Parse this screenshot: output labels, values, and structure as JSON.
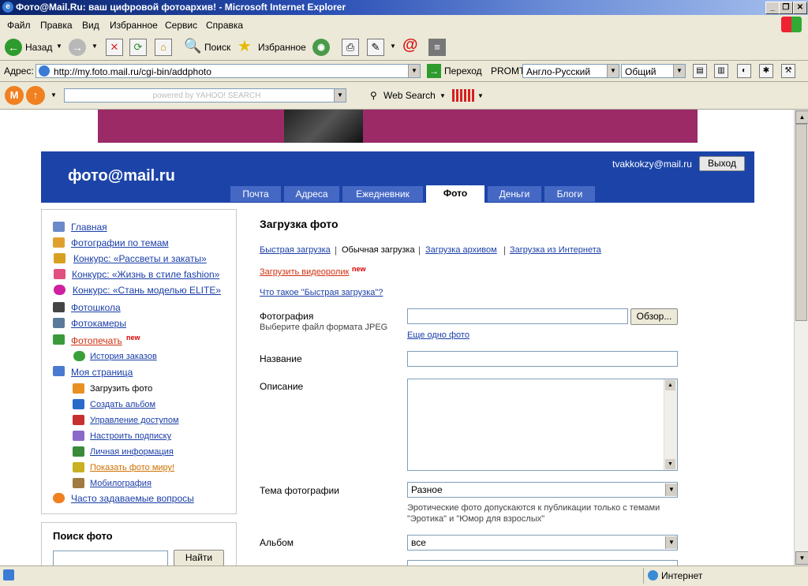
{
  "window": {
    "title": "Фото@Mail.Ru: ваш цифровой фотоархив! - Microsoft Internet Explorer"
  },
  "menu": [
    "Файл",
    "Правка",
    "Вид",
    "Избранное",
    "Сервис",
    "Справка"
  ],
  "toolbar": {
    "back": "Назад",
    "search": "Поиск",
    "favorites": "Избранное"
  },
  "address": {
    "label": "Адрес:",
    "url": "http://my.foto.mail.ru/cgi-bin/addphoto",
    "go": "Переход",
    "promt": "PROMT",
    "translate_dir": "Англо-Русский",
    "translate_type": "Общий"
  },
  "yahoo": {
    "placeholder": "powered by YAHOO! SEARCH",
    "web_search": "Web Search"
  },
  "status": {
    "zone": "Интернет"
  },
  "header": {
    "logo": "фото@mail.ru",
    "user": "tvakkokzy@mail.ru",
    "logout": "Выход",
    "tabs": [
      "Почта",
      "Адреса",
      "Ежедневник",
      "Фото",
      "Деньги",
      "Блоги"
    ]
  },
  "sidebar": {
    "items": [
      {
        "label": "Главная"
      },
      {
        "label": "Фотографии по темам"
      },
      {
        "label": "Конкурс: «Рассветы и закаты»"
      },
      {
        "label": "Конкурс: «Жизнь в стиле fashion»"
      },
      {
        "label": "Конкурс: «Стань моделью ELITE»"
      },
      {
        "label": "Фотошкола"
      },
      {
        "label": "Фотокамеры"
      },
      {
        "label": "Фотопечать"
      }
    ],
    "new_badge": "new",
    "history": "История заказов",
    "my_page": "Моя страница",
    "sub": [
      {
        "label": "Загрузить фото"
      },
      {
        "label": "Создать альбом"
      },
      {
        "label": "Управление доступом"
      },
      {
        "label": "Настроить подписку"
      },
      {
        "label": "Личная информация"
      },
      {
        "label": "Показать фото миру!"
      },
      {
        "label": "Мобилография"
      }
    ],
    "faq": "Часто задаваемые вопросы",
    "search_title": "Поиск фото",
    "search_button": "Найти"
  },
  "main": {
    "title": "Загрузка фото",
    "links": [
      "Быстрая загрузка",
      "Обычная загрузка",
      "Загрузка архивом",
      "Загрузка из Интернета"
    ],
    "video_link": "Загрузить видеоролик",
    "new_badge": "new",
    "what_is": "Что такое \"Быстрая загрузка\"?",
    "photo_label": "Фотография",
    "photo_hint": "Выберите файл формата JPEG",
    "browse": "Обзор...",
    "more_photo": "Еще одно фото",
    "name_label": "Название",
    "desc_label": "Описание",
    "theme_label": "Тема фотографии",
    "theme_value": "Разное",
    "theme_hint1": "Эротические фото допускаются к публикации только с темами",
    "theme_hint2": "\"Эротика\" и \"Юмор для взрослых\"",
    "album_label": "Альбом",
    "album_value": "все"
  }
}
